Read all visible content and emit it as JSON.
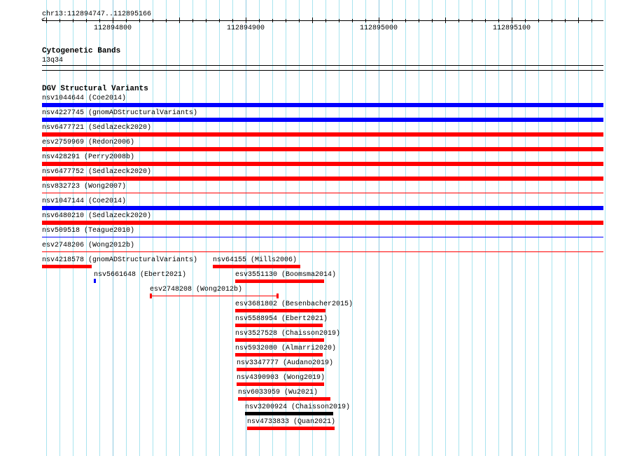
{
  "ruler": {
    "region": "chr13:112894747..112895166",
    "tick_labels": [
      "112894800",
      "112894900",
      "112895000",
      "112895100"
    ]
  },
  "cytoband_track": {
    "title": "Cytogenetic Bands",
    "band": "13q34"
  },
  "dgv_track": {
    "title": "DGV Structural Variants",
    "features": [
      {
        "label": "nsv1044644 (Coe2014)",
        "color": "#0000ff"
      },
      {
        "label": "nsv4227745 (gnomADStructuralVariants)",
        "color": "#0000ff"
      },
      {
        "label": "nsv6477721 (Sedlazeck2020)",
        "color": "#ff0000"
      },
      {
        "label": "esv2759969 (Redon2006)",
        "color": "#ff0000"
      },
      {
        "label": "nsv428291 (Perry2008b)",
        "color": "#ff0000"
      },
      {
        "label": "nsv6477752 (Sedlazeck2020)",
        "color": "#ff0000"
      },
      {
        "label": "nsv832723 (Wong2007)",
        "color": "#ff0000"
      },
      {
        "label": "nsv1047144 (Coe2014)",
        "color": "#0000ff"
      },
      {
        "label": "nsv6480210 (Sedlazeck2020)",
        "color": "#ff0000"
      },
      {
        "label": "nsv509518 (Teague2010)",
        "color": "#0000ff"
      },
      {
        "label": "esv2748206 (Wong2012b)",
        "color": "#ff0000"
      },
      {
        "label": "nsv4218578 (gnomADStructuralVariants)",
        "color": "#ff0000"
      },
      {
        "label": "nsv64155 (Mills2006)",
        "color": "#ff0000"
      },
      {
        "label": "nsv5661648 (Ebert2021)",
        "color": "#0000ff"
      },
      {
        "label": "esv3551130 (Boomsma2014)",
        "color": "#ff0000"
      },
      {
        "label": "esv2748208 (Wong2012b)",
        "color": "#ff0000"
      },
      {
        "label": "esv3681802 (Besenbacher2015)",
        "color": "#ff0000"
      },
      {
        "label": "nsv5588954 (Ebert2021)",
        "color": "#ff0000"
      },
      {
        "label": "nsv3527528 (Chaisson2019)",
        "color": "#ff0000"
      },
      {
        "label": "nsv5932080 (Almarri2020)",
        "color": "#ff0000"
      },
      {
        "label": "nsv3347777 (Audano2019)",
        "color": "#ff0000"
      },
      {
        "label": "nsv4390903 (Wong2019)",
        "color": "#ff0000"
      },
      {
        "label": "nsv6033959 (Wu2021)",
        "color": "#ff0000"
      },
      {
        "label": "nsv3200924 (Chaisson2019)",
        "color": "#000000"
      },
      {
        "label": "nsv4733833 (Quan2021)",
        "color": "#ff0000"
      }
    ]
  }
}
